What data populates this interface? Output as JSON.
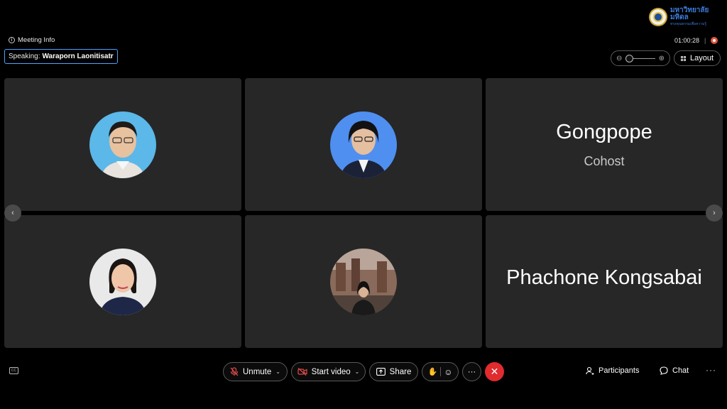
{
  "org_logo": {
    "line1": "มหาวิทยาลัยมหิดล",
    "line2": "ทรงคุณธรรมเพื่อความรู้"
  },
  "header": {
    "meeting_info_label": "Meeting Info",
    "speaking_prefix": "Speaking:",
    "speaking_name": "Waraporn Laonitisatr",
    "elapsed_time": "01:00:28",
    "layout_label": "Layout"
  },
  "participants": [
    {
      "kind": "photo",
      "description_icon": "person-avatar-icon",
      "bg": "#5bb8e8"
    },
    {
      "kind": "photo",
      "description_icon": "person-avatar-icon",
      "bg": "#4f8ff0"
    },
    {
      "kind": "name",
      "name": "Gongpope",
      "role": "Cohost"
    },
    {
      "kind": "photo",
      "description_icon": "person-avatar-icon",
      "bg": "#e9e9e9"
    },
    {
      "kind": "photo",
      "description_icon": "person-avatar-icon",
      "bg": "#8a6a5a"
    },
    {
      "kind": "name",
      "name": "Phachone Kongsabai",
      "role": ""
    }
  ],
  "controls": {
    "unmute_label": "Unmute",
    "start_video_label": "Start video",
    "share_label": "Share",
    "more_label": "···",
    "participants_label": "Participants",
    "chat_label": "Chat",
    "overflow_label": "···"
  },
  "colors": {
    "end_call": "#e02b2f",
    "speaking_border": "#4aa3ff",
    "tile_bg": "#272727",
    "recording": "#e0533f"
  }
}
